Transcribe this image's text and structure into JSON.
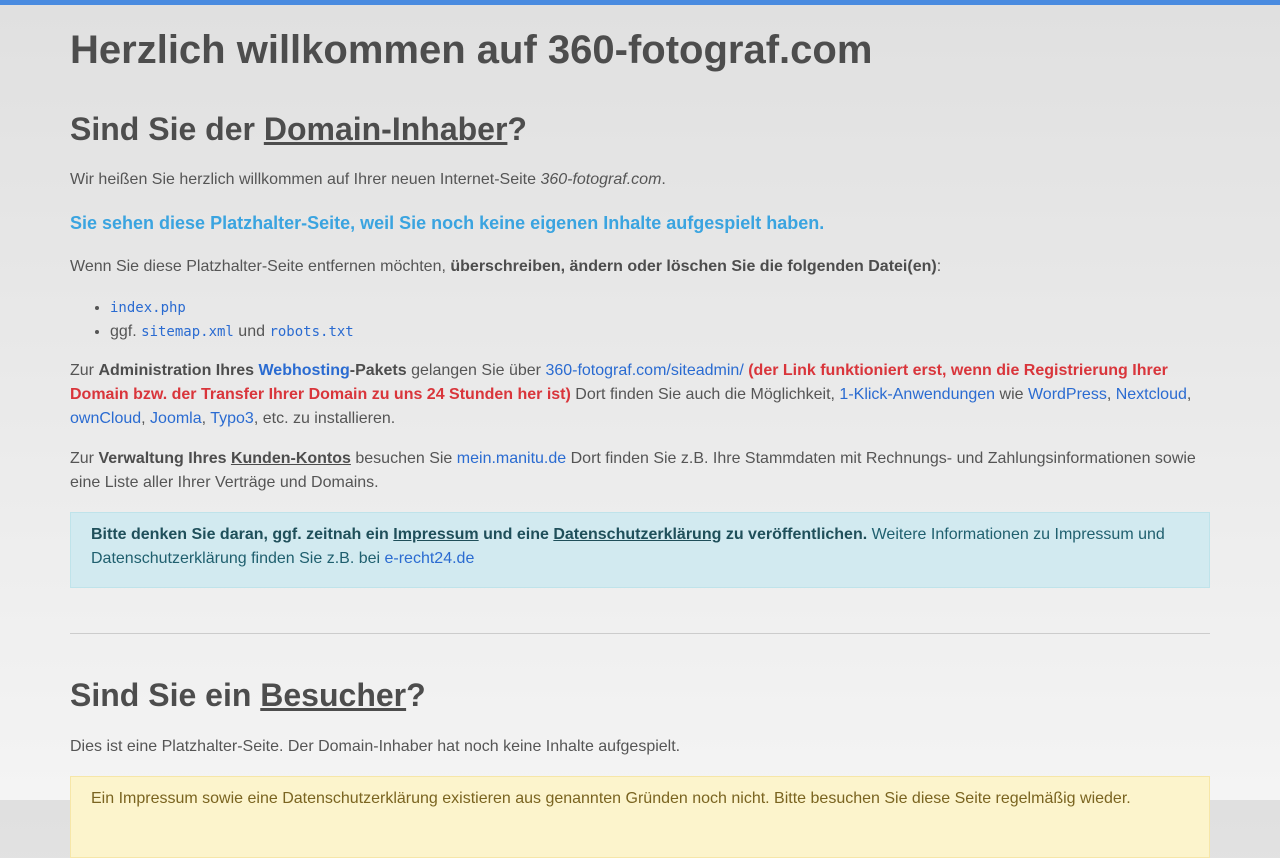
{
  "title": "Herzlich willkommen auf 360-fotograf.com",
  "owner_section": {
    "heading_prefix": "Sind Sie der ",
    "heading_link": "Domain-Inhaber",
    "heading_suffix": "?",
    "welcome_text": "Wir heißen Sie herzlich willkommen auf Ihrer neuen Internet-Seite ",
    "welcome_domain": "360-fotograf.com",
    "welcome_end": ".",
    "lead": "Sie sehen diese Platzhalter-Seite, weil Sie noch keine eigenen Inhalte aufgespielt haben.",
    "remove_text": "Wenn Sie diese Platzhalter-Seite entfernen möchten, ",
    "remove_bold": "überschreiben, ändern oder löschen Sie die folgenden Datei(en)",
    "remove_end": ":",
    "files": {
      "index": "index.php",
      "ggf": "ggf. ",
      "sitemap": "sitemap.xml",
      "und": " und ",
      "robots": "robots.txt"
    },
    "admin": {
      "zur": "Zur ",
      "admin_bold": "Administration Ihres ",
      "webhosting": "Webhosting",
      "pakets": "-Pakets",
      "gelangen": " gelangen Sie über ",
      "siteadmin": "360-fotograf.com/siteadmin/",
      "warning": " (der Link funktioniert erst, wenn die Registrierung Ihrer Domain bzw. der Transfer Ihrer Domain zu uns 24 Stunden her ist)",
      "dort": " Dort finden Sie auch die Möglichkeit, ",
      "klick": "1-Klick-Anwendungen",
      "wie": " wie ",
      "wordpress": "WordPress",
      "nextcloud": "Nextcloud",
      "owncloud": "ownCloud",
      "joomla": "Joomla",
      "typo3": "Typo3",
      "etc": ", etc. zu installieren."
    },
    "account": {
      "zur": "Zur ",
      "bold": "Verwaltung Ihres ",
      "kunden": "Kunden-Kontos",
      "besuchen": " besuchen Sie ",
      "link": "mein.manitu.de",
      "rest": " Dort finden Sie z.B. Ihre Stammdaten mit Rechnungs- und Zahlungsinformationen sowie eine Liste aller Ihrer Verträge und Domains."
    },
    "info": {
      "b1": "Bitte denken Sie daran, ggf. zeitnah ein ",
      "impressum": "Impressum",
      "b2": " und eine ",
      "datenschutz": "Datenschutzerklärung",
      "b3": " zu veröffentlichen.",
      "rest": " Weitere Informationen zu Impressum und Datenschutzerklärung finden Sie z.B. bei ",
      "link": "e-recht24.de"
    }
  },
  "visitor_section": {
    "heading_prefix": "Sind Sie ein ",
    "heading_link": "Besucher",
    "heading_suffix": "?",
    "text": "Dies ist eine Platzhalter-Seite. Der Domain-Inhaber hat noch keine Inhalte aufgespielt.",
    "warning": "Ein Impressum sowie eine Datenschutzerklärung existieren aus genannten Gründen noch nicht. Bitte besuchen Sie diese Seite regelmäßig wieder."
  },
  "colors": {
    "accent_bar": "#4a8be0",
    "link": "#2a6bd1",
    "lead": "#3aa4e0",
    "warning_red": "#d9353b"
  }
}
